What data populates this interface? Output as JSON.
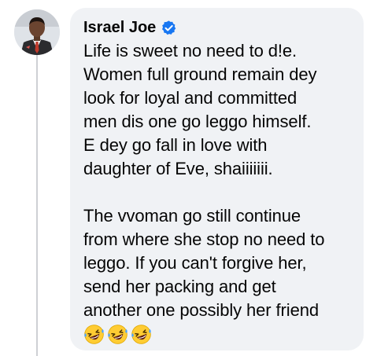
{
  "comment": {
    "author": "Israel Joe",
    "verified": true,
    "paragraphs": [
      {
        "lines": [
          "Life is sweet no need to d!e.",
          "Women full ground remain dey",
          "look for loyal and committed",
          "men dis one go leggo himself.",
          "E dey go fall in love with",
          "daughter of Eve, shaiiiiiii."
        ]
      },
      {
        "lines": [
          "The vvoman go still continue",
          "from where she stop no need to",
          "leggo. If you can't forgive her,",
          "send her packing and get",
          "another one possibly her friend"
        ]
      }
    ],
    "emojis": [
      "rolling-on-floor-laughing",
      "rolling-on-floor-laughing",
      "rolling-on-floor-laughing"
    ]
  },
  "colors": {
    "bubble_bg": "#f0f2f5",
    "text": "#050505",
    "verified_blue": "#1877f2",
    "thread_line": "#ced0d4"
  }
}
